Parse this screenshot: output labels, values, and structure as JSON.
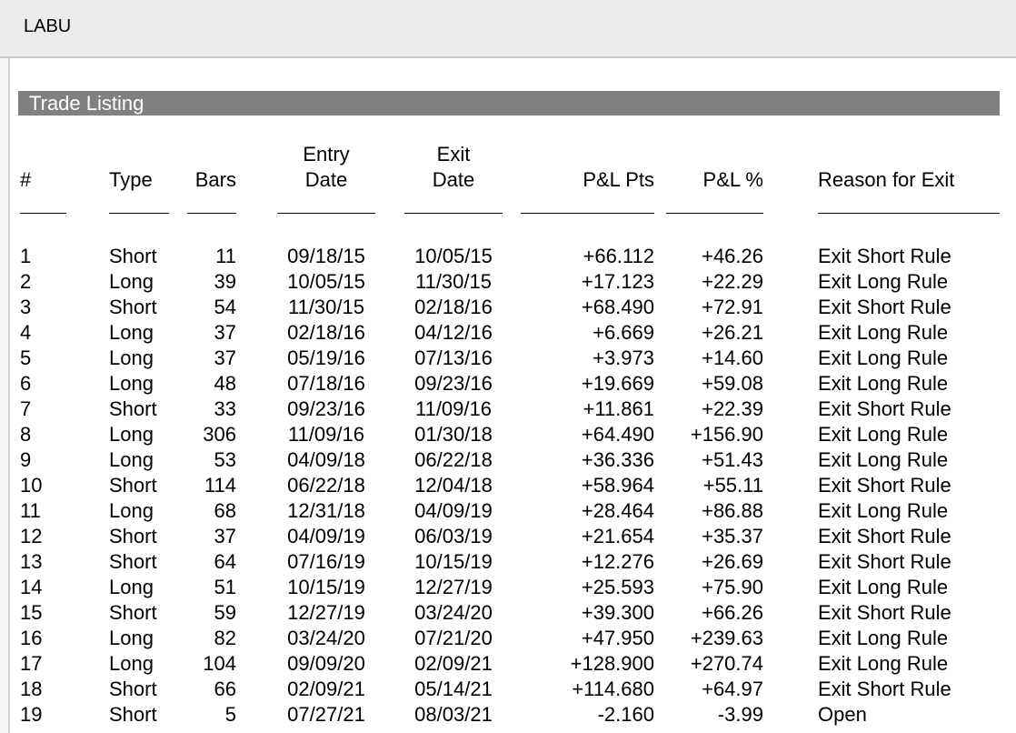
{
  "window": {
    "title": "LABU"
  },
  "section": {
    "title": "Trade Listing"
  },
  "columns": {
    "num": "#",
    "type": "Type",
    "bars": "Bars",
    "entry_line1": "Entry",
    "entry_line2": "Date",
    "exit_line1": "Exit",
    "exit_line2": "Date",
    "pl_pts": "P&L Pts",
    "pl_pct": "P&L %",
    "reason": "Reason for Exit"
  },
  "trades": [
    {
      "num": "1",
      "type": "Short",
      "bars": "11",
      "entry": "09/18/15",
      "exit": "10/05/15",
      "pts": "+66.112",
      "pct": "+46.26",
      "reason": "Exit Short Rule"
    },
    {
      "num": "2",
      "type": "Long",
      "bars": "39",
      "entry": "10/05/15",
      "exit": "11/30/15",
      "pts": "+17.123",
      "pct": "+22.29",
      "reason": "Exit Long Rule"
    },
    {
      "num": "3",
      "type": "Short",
      "bars": "54",
      "entry": "11/30/15",
      "exit": "02/18/16",
      "pts": "+68.490",
      "pct": "+72.91",
      "reason": "Exit Short Rule"
    },
    {
      "num": "4",
      "type": "Long",
      "bars": "37",
      "entry": "02/18/16",
      "exit": "04/12/16",
      "pts": "+6.669",
      "pct": "+26.21",
      "reason": "Exit Long Rule"
    },
    {
      "num": "5",
      "type": "Long",
      "bars": "37",
      "entry": "05/19/16",
      "exit": "07/13/16",
      "pts": "+3.973",
      "pct": "+14.60",
      "reason": "Exit Long Rule"
    },
    {
      "num": "6",
      "type": "Long",
      "bars": "48",
      "entry": "07/18/16",
      "exit": "09/23/16",
      "pts": "+19.669",
      "pct": "+59.08",
      "reason": "Exit Long Rule"
    },
    {
      "num": "7",
      "type": "Short",
      "bars": "33",
      "entry": "09/23/16",
      "exit": "11/09/16",
      "pts": "+11.861",
      "pct": "+22.39",
      "reason": "Exit Short Rule"
    },
    {
      "num": "8",
      "type": "Long",
      "bars": "306",
      "entry": "11/09/16",
      "exit": "01/30/18",
      "pts": "+64.490",
      "pct": "+156.90",
      "reason": "Exit Long Rule"
    },
    {
      "num": "9",
      "type": "Long",
      "bars": "53",
      "entry": "04/09/18",
      "exit": "06/22/18",
      "pts": "+36.336",
      "pct": "+51.43",
      "reason": "Exit Long Rule"
    },
    {
      "num": "10",
      "type": "Short",
      "bars": "114",
      "entry": "06/22/18",
      "exit": "12/04/18",
      "pts": "+58.964",
      "pct": "+55.11",
      "reason": "Exit Short Rule"
    },
    {
      "num": "11",
      "type": "Long",
      "bars": "68",
      "entry": "12/31/18",
      "exit": "04/09/19",
      "pts": "+28.464",
      "pct": "+86.88",
      "reason": "Exit Long Rule"
    },
    {
      "num": "12",
      "type": "Short",
      "bars": "37",
      "entry": "04/09/19",
      "exit": "06/03/19",
      "pts": "+21.654",
      "pct": "+35.37",
      "reason": "Exit Short Rule"
    },
    {
      "num": "13",
      "type": "Short",
      "bars": "64",
      "entry": "07/16/19",
      "exit": "10/15/19",
      "pts": "+12.276",
      "pct": "+26.69",
      "reason": "Exit Short Rule"
    },
    {
      "num": "14",
      "type": "Long",
      "bars": "51",
      "entry": "10/15/19",
      "exit": "12/27/19",
      "pts": "+25.593",
      "pct": "+75.90",
      "reason": "Exit Long Rule"
    },
    {
      "num": "15",
      "type": "Short",
      "bars": "59",
      "entry": "12/27/19",
      "exit": "03/24/20",
      "pts": "+39.300",
      "pct": "+66.26",
      "reason": "Exit Short Rule"
    },
    {
      "num": "16",
      "type": "Long",
      "bars": "82",
      "entry": "03/24/20",
      "exit": "07/21/20",
      "pts": "+47.950",
      "pct": "+239.63",
      "reason": "Exit Long Rule"
    },
    {
      "num": "17",
      "type": "Long",
      "bars": "104",
      "entry": "09/09/20",
      "exit": "02/09/21",
      "pts": "+128.900",
      "pct": "+270.74",
      "reason": "Exit Long Rule"
    },
    {
      "num": "18",
      "type": "Short",
      "bars": "66",
      "entry": "02/09/21",
      "exit": "05/14/21",
      "pts": "+114.680",
      "pct": "+64.97",
      "reason": "Exit Short Rule"
    },
    {
      "num": "19",
      "type": "Short",
      "bars": "5",
      "entry": "07/27/21",
      "exit": "08/03/21",
      "pts": "-2.160",
      "pct": "-3.99",
      "reason": "Open"
    }
  ]
}
